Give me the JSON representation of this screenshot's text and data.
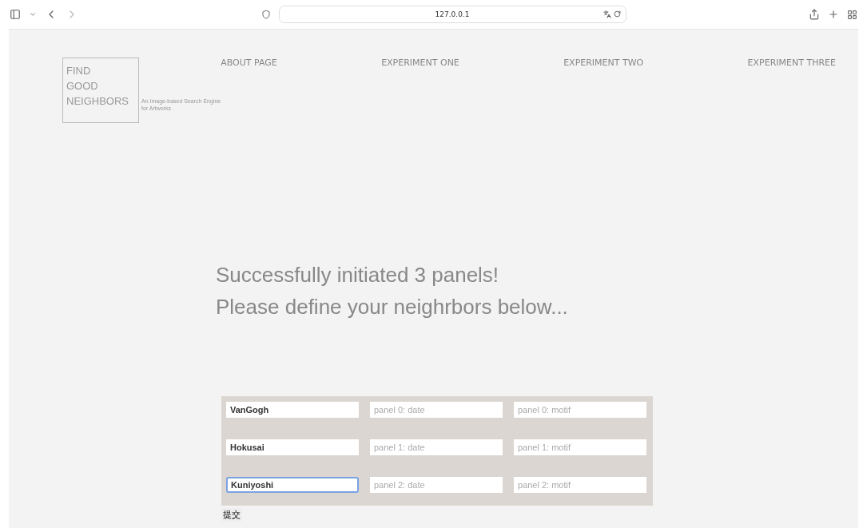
{
  "browser": {
    "address": "127.0.0.1"
  },
  "logo": {
    "lines": [
      "FIND",
      "GOOD",
      "NEIGHBORS"
    ],
    "tagline": [
      "An Image-based Search Engine",
      "for Artworks"
    ]
  },
  "nav": [
    "ABOUT PAGE",
    "EXPERIMENT ONE",
    "EXPERIMENT TWO",
    "EXPERIMENT THREE"
  ],
  "heading": [
    "Successfully initiated 3 panels!",
    "Please define your neighrbors below..."
  ],
  "panels": [
    {
      "name": {
        "value": "VanGogh",
        "focused": false
      },
      "date": {
        "placeholder": "panel 0: date"
      },
      "motif": {
        "placeholder": "panel 0: motif"
      }
    },
    {
      "name": {
        "value": "Hokusai",
        "focused": false
      },
      "date": {
        "placeholder": "panel 1: date"
      },
      "motif": {
        "placeholder": "panel 1: motif"
      }
    },
    {
      "name": {
        "value": "Kuniyoshi",
        "focused": true
      },
      "date": {
        "placeholder": "panel 2: date"
      },
      "motif": {
        "placeholder": "panel 2: motif"
      }
    }
  ],
  "submit": "提交"
}
